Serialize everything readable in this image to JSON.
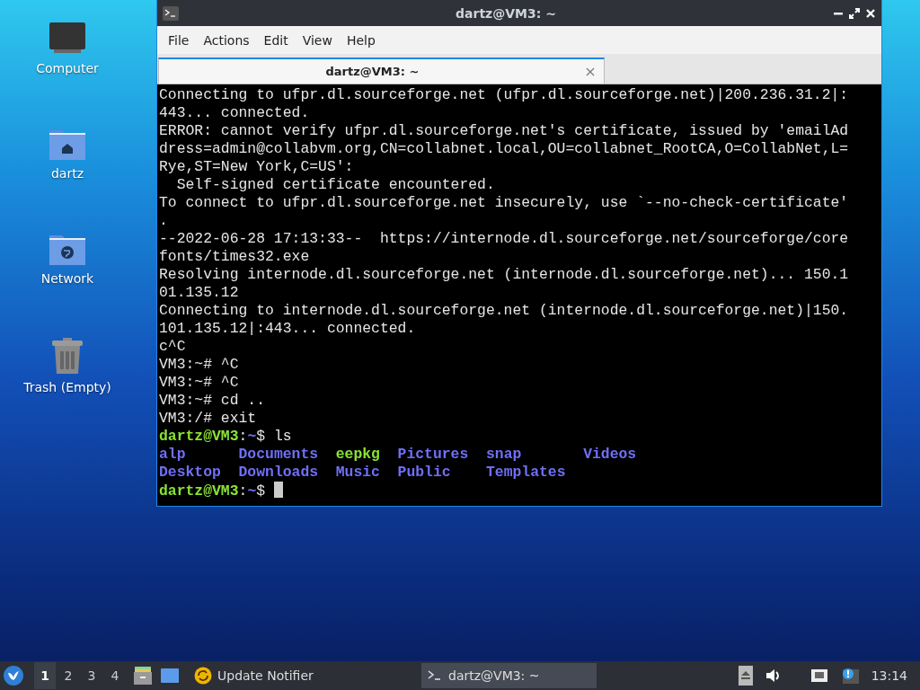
{
  "desktop_icons": [
    {
      "kind": "computer",
      "label": "Computer"
    },
    {
      "kind": "home",
      "label": "dartz"
    },
    {
      "kind": "network",
      "label": "Network"
    },
    {
      "kind": "trash",
      "label": "Trash (Empty)"
    }
  ],
  "window": {
    "title": "dartz@VM3: ~",
    "menu": [
      "File",
      "Actions",
      "Edit",
      "View",
      "Help"
    ],
    "tabs": [
      {
        "label": "dartz@VM3: ~",
        "selected": true
      }
    ],
    "terminal": {
      "lines": [
        [
          {
            "kind": "plain",
            "text": "Connecting to ufpr.dl.sourceforge.net (ufpr.dl.sourceforge.net)|200.236.31.2|:"
          }
        ],
        [
          {
            "kind": "plain",
            "text": "443... connected."
          }
        ],
        [
          {
            "kind": "plain",
            "text": "ERROR: cannot verify ufpr.dl.sourceforge.net's certificate, issued by 'emailAd"
          }
        ],
        [
          {
            "kind": "plain",
            "text": "dress=admin@collabvm.org,CN=collabnet.local,OU=collabnet_RootCA,O=CollabNet,L="
          }
        ],
        [
          {
            "kind": "plain",
            "text": "Rye,ST=New York,C=US':"
          }
        ],
        [
          {
            "kind": "plain",
            "text": "  Self-signed certificate encountered."
          }
        ],
        [
          {
            "kind": "plain",
            "text": "To connect to ufpr.dl.sourceforge.net insecurely, use `--no-check-certificate'"
          }
        ],
        [
          {
            "kind": "plain",
            "text": "."
          }
        ],
        [
          {
            "kind": "plain",
            "text": "--2022-06-28 17:13:33--  https://internode.dl.sourceforge.net/sourceforge/core"
          }
        ],
        [
          {
            "kind": "plain",
            "text": "fonts/times32.exe"
          }
        ],
        [
          {
            "kind": "plain",
            "text": "Resolving internode.dl.sourceforge.net (internode.dl.sourceforge.net)... 150.1"
          }
        ],
        [
          {
            "kind": "plain",
            "text": "01.135.12"
          }
        ],
        [
          {
            "kind": "plain",
            "text": "Connecting to internode.dl.sourceforge.net (internode.dl.sourceforge.net)|150."
          }
        ],
        [
          {
            "kind": "plain",
            "text": "101.135.12|:443... connected."
          }
        ],
        [
          {
            "kind": "plain",
            "text": "c^C"
          }
        ],
        [
          {
            "kind": "plain",
            "text": "VM3:~# ^C"
          }
        ],
        [
          {
            "kind": "plain",
            "text": "VM3:~# ^C"
          }
        ],
        [
          {
            "kind": "plain",
            "text": "VM3:~# cd .."
          }
        ],
        [
          {
            "kind": "plain",
            "text": "VM3:/# exit"
          }
        ],
        [
          {
            "kind": "user",
            "text": "dartz@VM3"
          },
          {
            "kind": "plain",
            "text": ":"
          },
          {
            "kind": "path",
            "text": "~"
          },
          {
            "kind": "plain",
            "text": "$ ls"
          }
        ]
      ],
      "listing": [
        {
          "kind": "dir",
          "text": "alp"
        },
        {
          "kind": "dir",
          "text": "Documents"
        },
        {
          "kind": "exec",
          "text": "eepkg"
        },
        {
          "kind": "dir",
          "text": "Pictures"
        },
        {
          "kind": "dir",
          "text": "snap"
        },
        {
          "kind": "dir",
          "text": "Videos"
        },
        {
          "kind": "dir",
          "text": "Desktop"
        },
        {
          "kind": "dir",
          "text": "Downloads"
        },
        {
          "kind": "dir",
          "text": "Music"
        },
        {
          "kind": "dir",
          "text": "Public"
        },
        {
          "kind": "dir",
          "text": "Templates"
        }
      ],
      "prompt": [
        {
          "kind": "user",
          "text": "dartz@VM3"
        },
        {
          "kind": "plain",
          "text": ":"
        },
        {
          "kind": "path",
          "text": "~"
        },
        {
          "kind": "plain",
          "text": "$"
        }
      ]
    }
  },
  "taskbar": {
    "workspaces": [
      {
        "label": "1",
        "selected": true
      },
      {
        "label": "2",
        "selected": false
      },
      {
        "label": "3",
        "selected": false
      },
      {
        "label": "4",
        "selected": false
      }
    ],
    "tasks": [
      {
        "kind": "update",
        "label": "Update Notifier",
        "selected": false
      },
      {
        "kind": "terminal",
        "label": "dartz@VM3: ~",
        "selected": true
      }
    ],
    "clock": "13:14"
  }
}
